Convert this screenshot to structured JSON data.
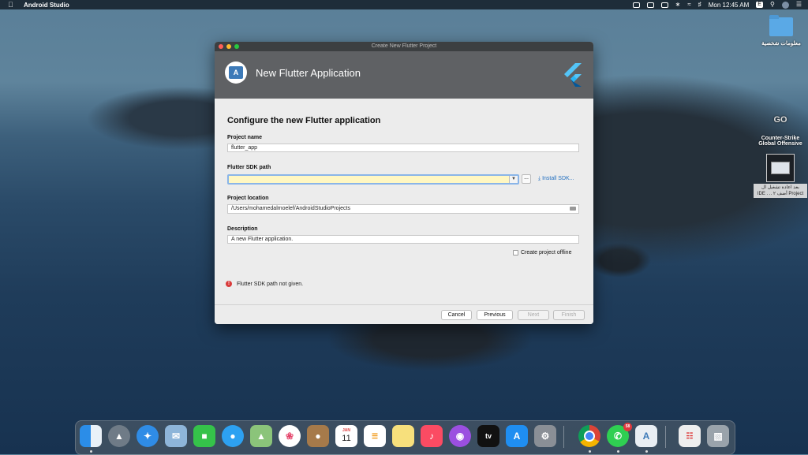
{
  "menubar": {
    "app_name": "Android Studio",
    "clock": "Mon 12:45 AM",
    "lang": "E"
  },
  "desktop": {
    "folder_label": "معلومات شخصية",
    "csgo_logo": "GO",
    "csgo_label_1": "Counter-Strike",
    "csgo_label_2": "Global Offensive",
    "shortcut_label_1": "بعد اعادة تشغيل ال",
    "shortcut_label_2": "IDE . .. أضف ٢ Project"
  },
  "dialog": {
    "window_title": "Create New Flutter Project",
    "banner_title": "New Flutter Application",
    "heading": "Configure the new Flutter application",
    "project_name_label": "Project name",
    "project_name_value": "flutter_app",
    "sdk_path_label": "Flutter SDK path",
    "sdk_path_value": "",
    "browse_label": "...",
    "install_sdk_label": "Install SDK...",
    "location_label": "Project location",
    "location_value": "/Users/mohamedalmoelef/AndroidStudioProjects",
    "description_label": "Description",
    "description_value": "A new Flutter application.",
    "offline_label": "Create project offline",
    "offline_checked": false,
    "error_text": "Flutter SDK path not given.",
    "buttons": {
      "cancel": "Cancel",
      "previous": "Previous",
      "next": "Next",
      "finish": "Finish"
    }
  },
  "dock": {
    "calendar_month": "JAN",
    "calendar_day": "11",
    "whatsapp_badge": "58",
    "tv_label": "tv",
    "items": [
      "finder-icon",
      "launchpad-icon",
      "safari-icon",
      "mail-icon",
      "facetime-icon",
      "messages-icon",
      "maps-icon",
      "photos-icon",
      "contacts-icon",
      "calendar-icon",
      "reminders-icon",
      "notes-icon",
      "music-icon",
      "podcasts-icon",
      "tv-icon",
      "app-store-icon",
      "system-preferences-icon",
      "chrome-icon",
      "whatsapp-icon",
      "android-studio-icon",
      "database-icon",
      "trash-icon"
    ]
  }
}
